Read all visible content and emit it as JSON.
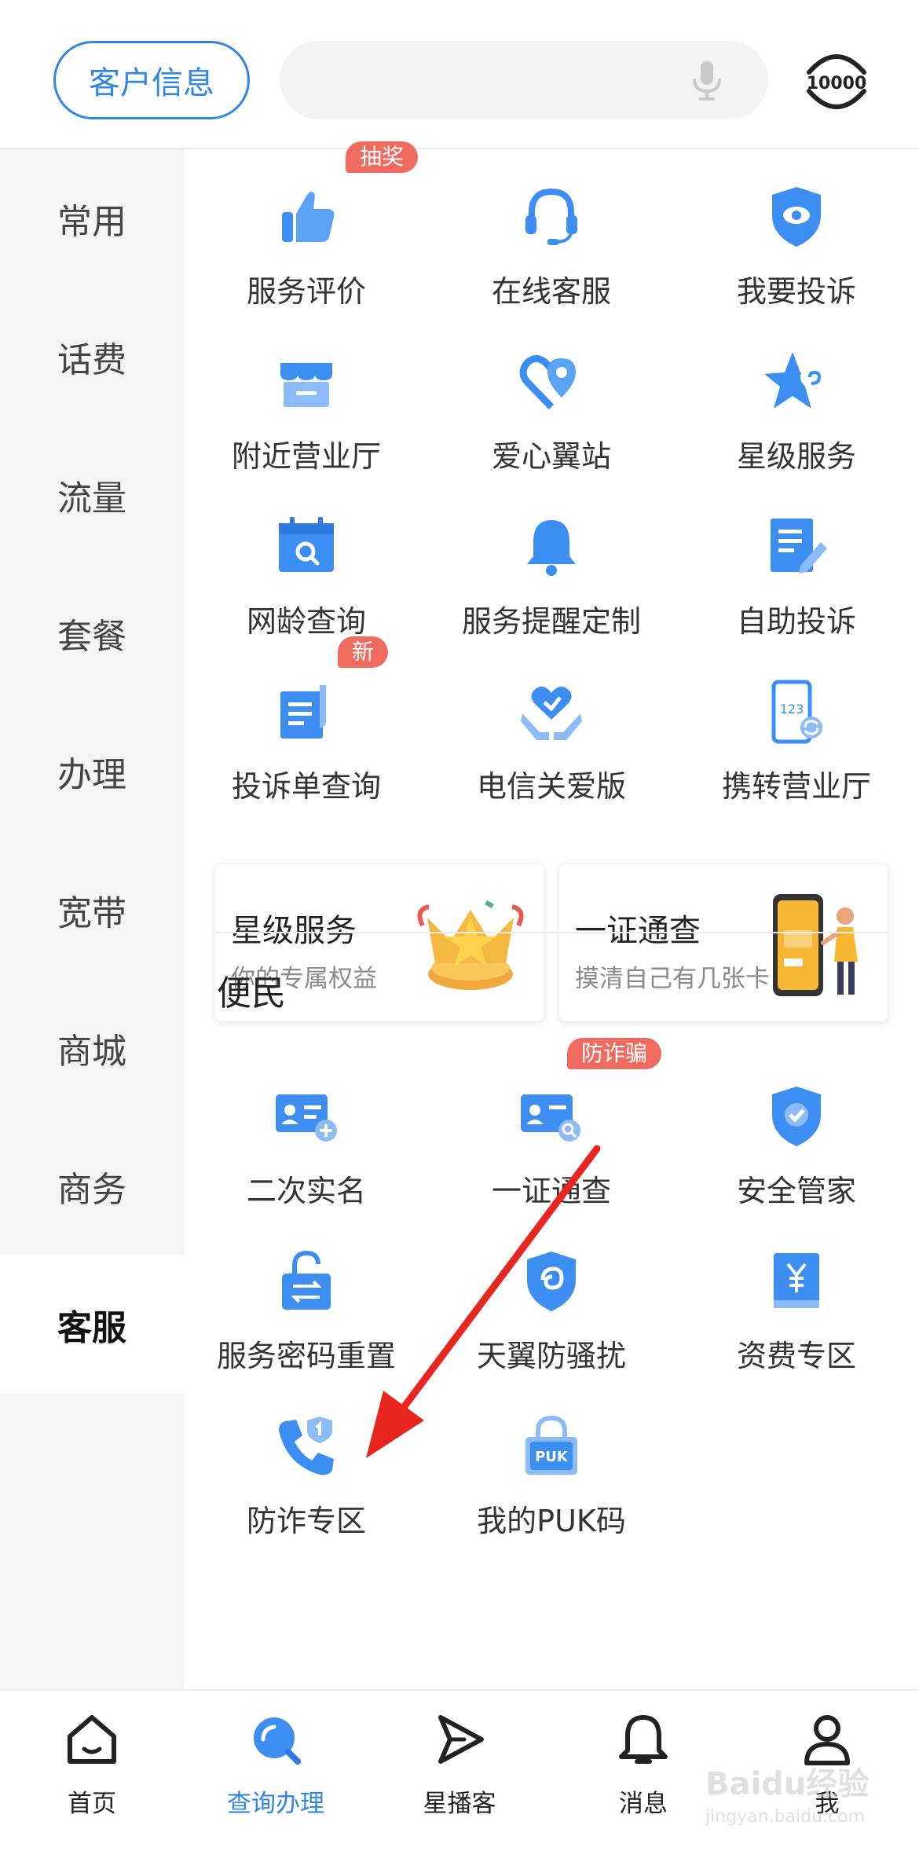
{
  "header": {
    "customer_button": "客户信息",
    "search_placeholder": "",
    "mic_icon": "microphone-icon",
    "logo_text": "10000"
  },
  "sidebar": {
    "items": [
      {
        "label": "常用"
      },
      {
        "label": "话费"
      },
      {
        "label": "流量"
      },
      {
        "label": "套餐"
      },
      {
        "label": "办理"
      },
      {
        "label": "宽带"
      },
      {
        "label": "商城"
      },
      {
        "label": "商务"
      },
      {
        "label": "客服",
        "active": true
      }
    ]
  },
  "service_grid": [
    {
      "label": "服务评价",
      "icon": "thumbs-up-icon",
      "badge": "抽奖"
    },
    {
      "label": "在线客服",
      "icon": "headset-icon"
    },
    {
      "label": "我要投诉",
      "icon": "shield-eye-icon"
    },
    {
      "label": "附近营业厅",
      "icon": "store-icon"
    },
    {
      "label": "爱心翼站",
      "icon": "heart-pin-icon"
    },
    {
      "label": "星级服务",
      "icon": "star-icon"
    },
    {
      "label": "网龄查询",
      "icon": "calendar-search-icon"
    },
    {
      "label": "服务提醒定制",
      "icon": "bell-icon"
    },
    {
      "label": "自助投诉",
      "icon": "edit-document-icon"
    },
    {
      "label": "投诉单查询",
      "icon": "complaint-doc-icon",
      "badge": "新"
    },
    {
      "label": "电信关爱版",
      "icon": "hands-heart-icon"
    },
    {
      "label": "携转营业厅",
      "icon": "phone-123-icon"
    }
  ],
  "cards": [
    {
      "title": "星级服务",
      "subtitle": "你的专属权益",
      "image": "star-crown-illustration"
    },
    {
      "title": "一证通查",
      "subtitle": "摸清自己有几张卡",
      "image": "phone-person-illustration"
    }
  ],
  "convenience": {
    "title": "便民",
    "items": [
      {
        "label": "二次实名",
        "icon": "id-card-plus-icon"
      },
      {
        "label": "一证通查",
        "icon": "id-card-search-icon",
        "badge": "防诈骗"
      },
      {
        "label": "安全管家",
        "icon": "shield-check-icon"
      },
      {
        "label": "服务密码重置",
        "icon": "lock-reset-icon"
      },
      {
        "label": "天翼防骚扰",
        "icon": "shield-swirl-icon"
      },
      {
        "label": "资费专区",
        "icon": "yuan-book-icon"
      },
      {
        "label": "防诈专区",
        "icon": "phone-shield-icon"
      },
      {
        "label": "我的PUK码",
        "icon": "puk-lock-icon"
      }
    ]
  },
  "bottom_nav": [
    {
      "label": "首页",
      "icon": "home-icon"
    },
    {
      "label": "查询办理",
      "icon": "search-query-icon",
      "active": true
    },
    {
      "label": "星播客",
      "icon": "play-icon"
    },
    {
      "label": "消息",
      "icon": "bell-icon"
    },
    {
      "label": "我",
      "icon": "user-icon"
    }
  ],
  "watermark": {
    "line1": "Baidu经验",
    "line2": "jingyan.baidu.com"
  },
  "colors": {
    "accent": "#2f86e6",
    "badge": "#f06b5f",
    "arrow": "#e8261f",
    "icon_blue": "#3d8ef3"
  }
}
